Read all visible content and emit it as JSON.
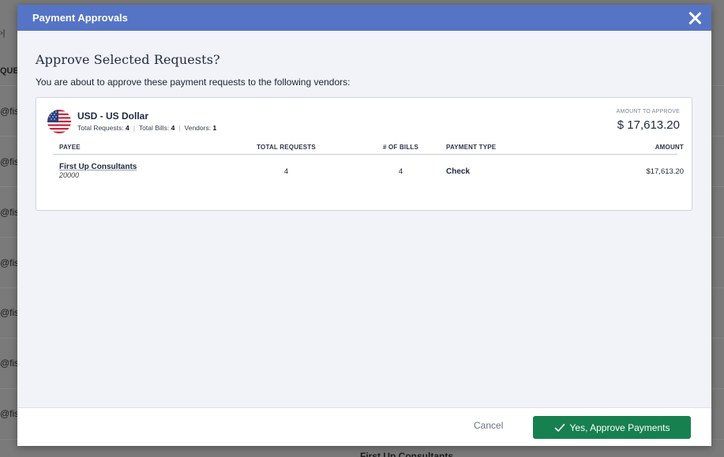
{
  "background": {
    "top_text": "›|",
    "column_header": "QUE",
    "row_text": "@fisp",
    "bottom_text": "First Up Consultants"
  },
  "modal": {
    "title": "Payment Approvals",
    "heading": "Approve Selected Requests?",
    "subtext": "You are about to approve these payment requests to the following vendors:",
    "currency": {
      "name": "USD - US Dollar",
      "total_requests_label": "Total Requests:",
      "total_requests": "4",
      "total_bills_label": "Total Bills:",
      "total_bills": "4",
      "vendors_label": "Vendors:",
      "vendors": "1",
      "amount_label": "AMOUNT TO APPROVE",
      "amount": "$ 17,613.20"
    },
    "table": {
      "columns": [
        "PAYEE",
        "TOTAL REQUESTS",
        "# OF BILLS",
        "PAYMENT TYPE",
        "AMOUNT"
      ],
      "rows": [
        {
          "payee": "First Up Consultants",
          "payee_id": "20000",
          "total_requests": "4",
          "bills": "4",
          "payment_type": "Check",
          "amount": "$17,613.20"
        }
      ]
    },
    "footer": {
      "cancel_label": "Cancel",
      "approve_label": "Yes, Approve Payments"
    }
  },
  "colors": {
    "header": "#5574c5",
    "approve": "#16804f"
  }
}
